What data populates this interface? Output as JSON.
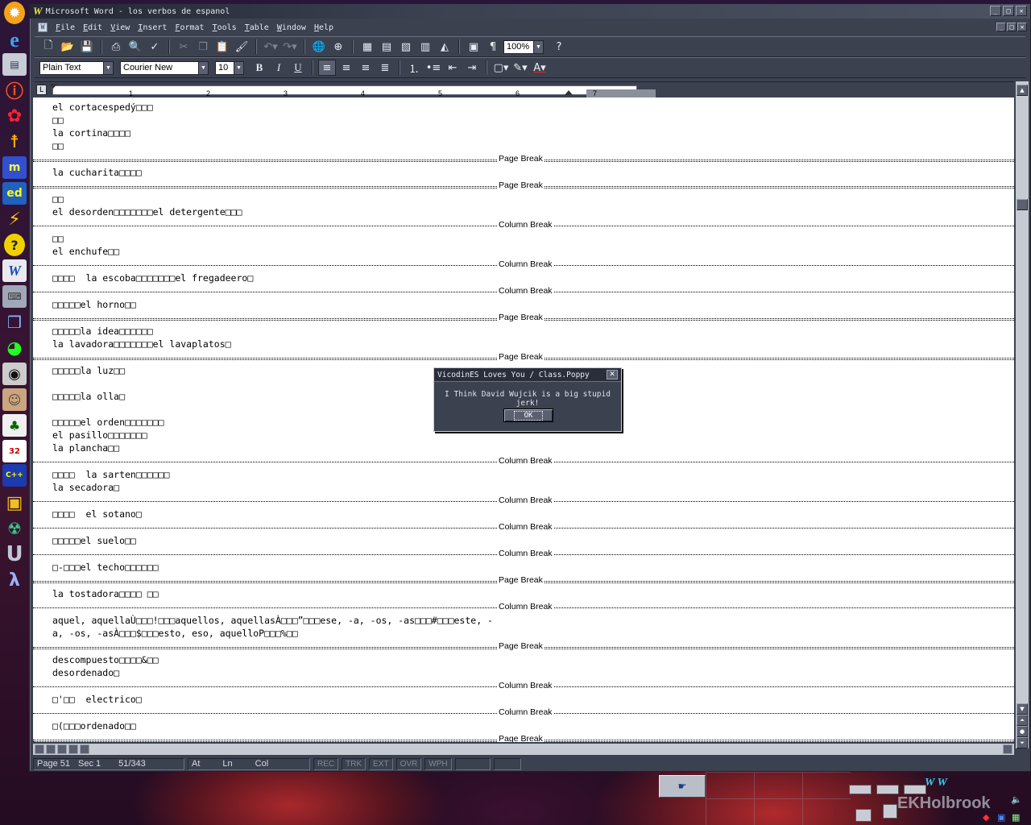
{
  "window": {
    "title": "Microsoft Word - los verbos de espanol",
    "minimize": "_",
    "maximize": "□",
    "close": "✕"
  },
  "menu": [
    "File",
    "Edit",
    "View",
    "Insert",
    "Format",
    "Tools",
    "Table",
    "Window",
    "Help"
  ],
  "toolbar": {
    "zoom": "100%",
    "style": "Plain Text",
    "font": "Courier New",
    "size": "10",
    "bold": "B",
    "italic": "I",
    "underline": "U"
  },
  "ruler": {
    "tab_selector": "L",
    "numbers": [
      "1",
      "2",
      "3",
      "4",
      "5",
      "6",
      "7"
    ]
  },
  "document": {
    "blocks": [
      {
        "type": "text",
        "text": "el cortacespedý□□□"
      },
      {
        "type": "text",
        "text": "□□"
      },
      {
        "type": "text",
        "text": "la cortina□□□□"
      },
      {
        "type": "text",
        "text": "□□"
      },
      {
        "type": "page",
        "text": "Page Break"
      },
      {
        "type": "text",
        "text": "la cucharita□□□□"
      },
      {
        "type": "page",
        "text": "Page Break"
      },
      {
        "type": "text",
        "text": "□□"
      },
      {
        "type": "text",
        "text": "el desorden□□□□□□□el detergente□□□"
      },
      {
        "type": "column",
        "text": "Column Break"
      },
      {
        "type": "text",
        "text": "□□"
      },
      {
        "type": "text",
        "text": "el enchufe□□"
      },
      {
        "type": "column",
        "text": "Column Break"
      },
      {
        "type": "text",
        "text": "□□□□  la escoba□□□□□□□el fregadeero□"
      },
      {
        "type": "column",
        "text": "Column Break"
      },
      {
        "type": "text",
        "text": "□□□□□el horno□□"
      },
      {
        "type": "page",
        "text": "Page Break"
      },
      {
        "type": "text",
        "text": "□□□□□la idea□□□□□□"
      },
      {
        "type": "text",
        "text": "la lavadora□□□□□□□el lavaplatos□"
      },
      {
        "type": "page",
        "text": "Page Break"
      },
      {
        "type": "text",
        "text": "□□□□□la luz□□"
      },
      {
        "type": "gap"
      },
      {
        "type": "text",
        "text": "□□□□□la olla□"
      },
      {
        "type": "gap"
      },
      {
        "type": "text",
        "text": "□□□□□el orden□□□□□□□"
      },
      {
        "type": "text",
        "text": "el pasillo□□□□□□□"
      },
      {
        "type": "text",
        "text": "la plancha□□"
      },
      {
        "type": "column",
        "text": "Column Break"
      },
      {
        "type": "text",
        "text": "□□□□  la sarten□□□□□□"
      },
      {
        "type": "text",
        "text": "la secadora□"
      },
      {
        "type": "column",
        "text": "Column Break"
      },
      {
        "type": "text",
        "text": "□□□□  el sotano□"
      },
      {
        "type": "column",
        "text": "Column Break"
      },
      {
        "type": "text",
        "text": "□□□□□el suelo□□"
      },
      {
        "type": "column",
        "text": "Column Break"
      },
      {
        "type": "text",
        "text": "□-□□□el techo□□□□□□"
      },
      {
        "type": "page",
        "text": "Page Break"
      },
      {
        "type": "text",
        "text": "la tostadora□□□□ □□"
      },
      {
        "type": "column",
        "text": "Column Break"
      },
      {
        "type": "text",
        "text": "aquel, aquellaÙ□□□!□□□aquellos, aquellasÀ□□□”□□□ese, -a, -os, -as□□□#□□□este, -"
      },
      {
        "type": "text",
        "text": "a, -os, -asÀ□□□$□□□esto, eso, aquelloP□□□%□□"
      },
      {
        "type": "page",
        "text": "Page Break"
      },
      {
        "type": "text",
        "text": "descompuesto□□□□&□□"
      },
      {
        "type": "text",
        "text": "desordenado□"
      },
      {
        "type": "column",
        "text": "Column Break"
      },
      {
        "type": "text",
        "text": "□'□□  electrico□"
      },
      {
        "type": "column",
        "text": "Column Break"
      },
      {
        "type": "text",
        "text": "□(□□□ordenado□□"
      },
      {
        "type": "page",
        "text": "Page Break"
      }
    ]
  },
  "status": {
    "page": "Page 51",
    "sec": "Sec 1",
    "pos": "51/343",
    "at": "At",
    "ln": "Ln",
    "col": "Col",
    "modes": [
      "REC",
      "TRK",
      "EXT",
      "OVR",
      "WPH"
    ]
  },
  "dialog": {
    "title": "VicodinES Loves You / Class.Poppy",
    "message": "I Think David Wujcik is a big stupid jerk!",
    "ok": "OK"
  },
  "tray": {
    "ww": "W W",
    "watermark": "EKHolbrook"
  }
}
